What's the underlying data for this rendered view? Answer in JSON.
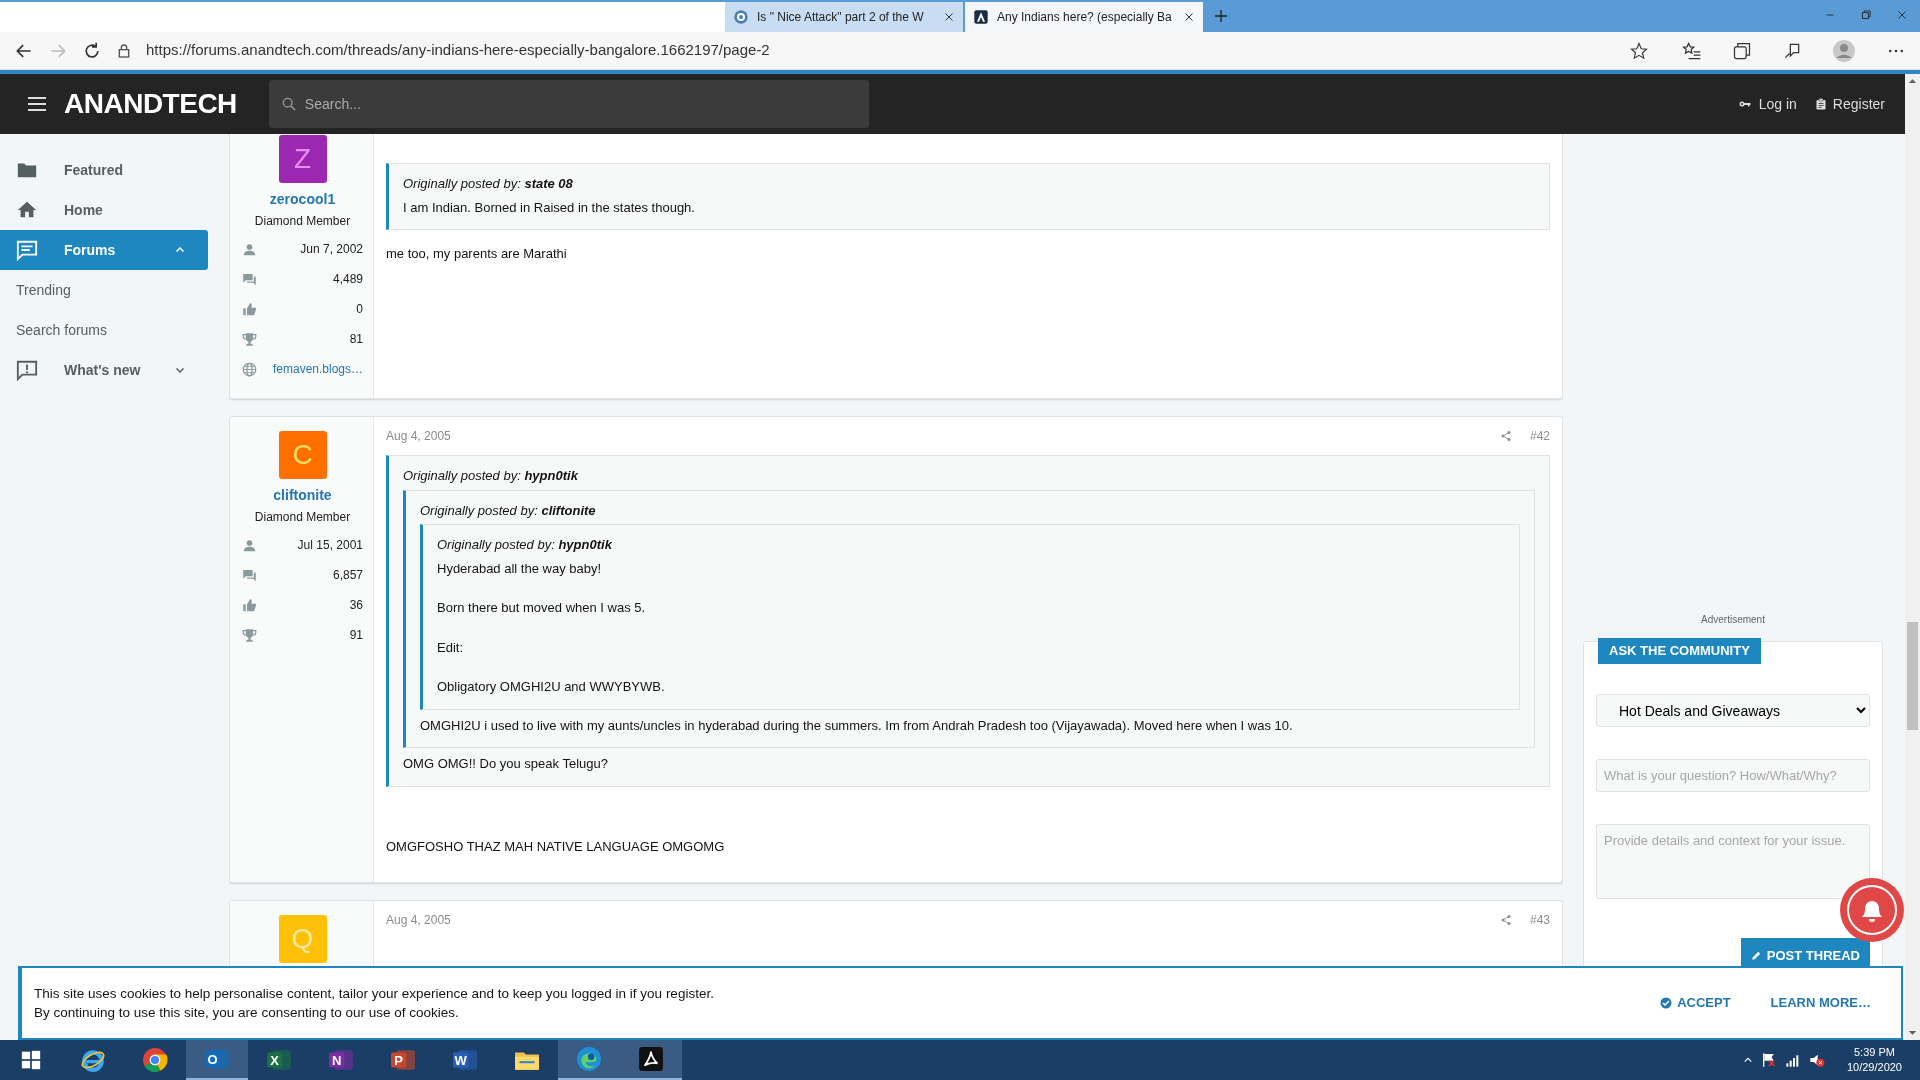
{
  "browser": {
    "tabs": [
      {
        "title": "Is \" Nice Attack\" part 2 of the W",
        "selected": false
      },
      {
        "title": "Any Indians here? (especially Ba",
        "selected": true
      }
    ],
    "url": "https://forums.anandtech.com/threads/any-indians-here-especially-bangalore.1662197/page-2"
  },
  "header": {
    "logo": "ANANDTECH",
    "search_placeholder": "Search...",
    "login": "Log in",
    "register": "Register"
  },
  "sidebar": {
    "items": [
      {
        "label": "Featured",
        "kind": "main",
        "selected": false
      },
      {
        "label": "Home",
        "kind": "main",
        "selected": false
      },
      {
        "label": "Forums",
        "kind": "main",
        "selected": true,
        "expanded": true
      },
      {
        "label": "Trending",
        "kind": "sub",
        "selected": false
      },
      {
        "label": "Search forums",
        "kind": "sub",
        "selected": false
      },
      {
        "label": "What's new",
        "kind": "main",
        "selected": false,
        "expanded": false
      }
    ]
  },
  "posts": [
    {
      "avatar_letter": "Z",
      "color": "#9c27b0",
      "username": "zerocool1",
      "user_title": "Diamond Member",
      "stats": [
        {
          "kind": "joined",
          "value": "Jun 7, 2002"
        },
        {
          "kind": "messages",
          "value": "4,489"
        },
        {
          "kind": "reactions",
          "value": "0"
        },
        {
          "kind": "points",
          "value": "81"
        },
        {
          "kind": "website",
          "value": "femaven.blogs…"
        }
      ],
      "body": [
        {
          "kind": "quote",
          "attribution": "Originally posted by:",
          "author": "state 08",
          "children": [
            {
              "kind": "text",
              "text": "I am Indian. Borned in Raised in the states though."
            }
          ]
        },
        {
          "kind": "text",
          "text": "me too, my parents are Marathi"
        }
      ]
    },
    {
      "avatar_letter": "C",
      "color": "#ff6f00",
      "username": "cliftonite",
      "user_title": "Diamond Member",
      "date": "Aug 4, 2005",
      "number": "#42",
      "stats": [
        {
          "kind": "joined",
          "value": "Jul 15, 2001"
        },
        {
          "kind": "messages",
          "value": "6,857"
        },
        {
          "kind": "reactions",
          "value": "36"
        },
        {
          "kind": "points",
          "value": "91"
        }
      ],
      "body": [
        {
          "kind": "quote",
          "attribution": "Originally posted by:",
          "author": "hypn0tik",
          "children": [
            {
              "kind": "quote",
              "attribution": "Originally posted by:",
              "author": "cliftonite",
              "children": [
                {
                  "kind": "quote",
                  "attribution": "Originally posted by:",
                  "author": "hypn0tik",
                  "children": [
                    {
                      "kind": "text",
                      "text": "Hyderabad all the way baby!"
                    },
                    {
                      "kind": "text",
                      "text": "Born there but moved when I was 5."
                    },
                    {
                      "kind": "text",
                      "text": "Edit:"
                    },
                    {
                      "kind": "text",
                      "text": "Obligatory OMGHI2U and WWYBYWB."
                    }
                  ]
                },
                {
                  "kind": "text",
                  "text": "OMGHI2U i used to live with my aunts/uncles in hyderabad during the summers. Im from Andrah Pradesh too (Vijayawada). Moved here when I was 10."
                }
              ]
            },
            {
              "kind": "text",
              "text": "OMG OMG!! Do you speak Telugu?"
            }
          ]
        },
        {
          "kind": "text",
          "text": "OMGFOSHO THAZ MAH NATIVE LANGUAGE OMGOMG"
        }
      ]
    },
    {
      "avatar_letter": "Q",
      "color": "#ffc107",
      "date": "Aug 4, 2005",
      "number": "#43"
    }
  ],
  "aside": {
    "ad_label": "Advertisement",
    "ask_label": "ASK THE COMMUNITY",
    "forum": "Hot Deals and Giveaways",
    "question_placeholder": "What is your question? How/What/Why?",
    "details_placeholder": "Provide details and context for your issue.",
    "post_button": "POST THREAD"
  },
  "cookie": {
    "lines": [
      "This site uses cookies to help personalise content, tailor your experience and to keep you logged in if you register.",
      "By continuing to use this site, you are consenting to our use of cookies."
    ],
    "accept": "ACCEPT",
    "learn_more": "LEARN MORE…"
  },
  "taskbar": {
    "apps": [
      {
        "kind": "start",
        "active": false
      },
      {
        "kind": "ie",
        "active": false
      },
      {
        "kind": "chrome",
        "active": false
      },
      {
        "kind": "office",
        "glyph": "O",
        "color": "#0f6cbd",
        "active": true
      },
      {
        "kind": "office",
        "glyph": "X",
        "color": "#1d7044",
        "active": false
      },
      {
        "kind": "office",
        "glyph": "N",
        "color": "#7b2fa3",
        "active": false
      },
      {
        "kind": "office",
        "glyph": "P",
        "color": "#c9472b",
        "active": false
      },
      {
        "kind": "office",
        "glyph": "W",
        "color": "#2b5fb4",
        "active": false
      },
      {
        "kind": "explorer",
        "active": false
      },
      {
        "kind": "edge",
        "active": true
      },
      {
        "kind": "acrobat",
        "active": true
      }
    ],
    "time": "5:39 PM",
    "date": "10/29/2020"
  }
}
